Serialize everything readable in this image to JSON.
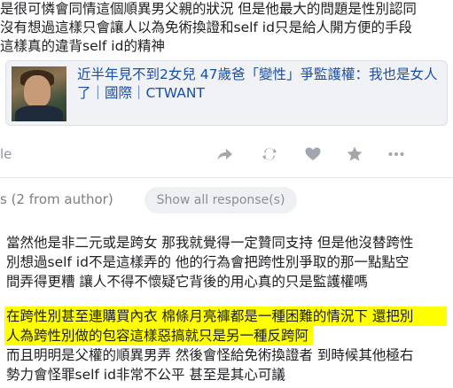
{
  "post": {
    "lines": [
      "是很可憐會同情這個順異男父親的狀況 但是他最大的問題是性別認同",
      "沒有想過這樣只會讓人以為免術換證和self id只是給人開方便的手段",
      "這樣真的違背self id的精神"
    ]
  },
  "link_card": {
    "title": "近半年見不到2女兒 47歲爸「變性」爭監護權：我也是女人了｜國際｜CTWANT"
  },
  "action_bar": {
    "share_label": "le",
    "icons": [
      "share-icon",
      "retweet-icon",
      "heart-icon",
      "star-icon",
      "more-icon"
    ]
  },
  "responses": {
    "header": "s (2 from author)",
    "show_all_label": "Show all response(s)"
  },
  "reply1": {
    "lines": [
      "當然他是非二元或是跨女 那我就覺得一定贊同支持 但是他沒替跨性",
      "別想過self id不是這樣弄的 他的行為會把跨性別爭取的那一點點空",
      "間弄得更糟 讓人不得不懷疑它背後的用心真的只是監護權嗎"
    ]
  },
  "reply2": {
    "highlighted_lines": [
      "在跨性別甚至連購買內衣 棉條月亮褲都是一種困難的情況下 還把別",
      "人為跨性別做的包容這樣惡搞就只是另一種反跨阿"
    ],
    "lines": [
      "而且明明是父權的順異男弄 然後會怪給免術換證者 到時候其他極右",
      "勢力會怪罪self id非常不公平 甚至是其心可議"
    ]
  },
  "colors": {
    "link": "#1a4fa8",
    "highlight": "#ffff00",
    "muted": "#90949c"
  }
}
